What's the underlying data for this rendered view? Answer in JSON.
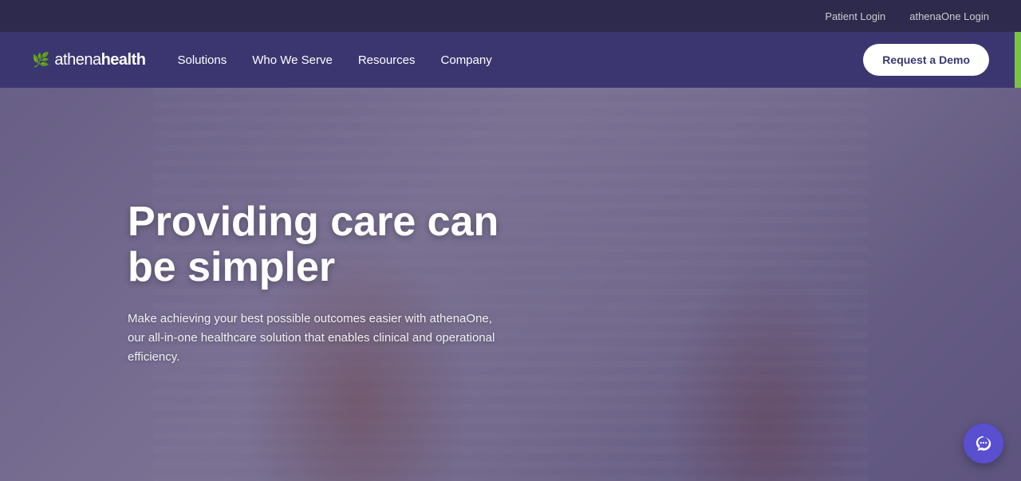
{
  "topbar": {
    "patient_login": "Patient Login",
    "athenaone_login": "athenaOne Login"
  },
  "navbar": {
    "logo_icon": "🌿",
    "logo_prefix": "athena",
    "logo_suffix": "health",
    "links": [
      {
        "id": "solutions",
        "label": "Solutions"
      },
      {
        "id": "who-we-serve",
        "label": "Who We Serve"
      },
      {
        "id": "resources",
        "label": "Resources"
      },
      {
        "id": "company",
        "label": "Company"
      }
    ],
    "cta_label": "Request a Demo"
  },
  "hero": {
    "title": "Providing care can be simpler",
    "subtitle": "Make achieving your best possible outcomes easier with athenaOne, our all-in-one healthcare solution that enables clinical and operational efficiency."
  }
}
